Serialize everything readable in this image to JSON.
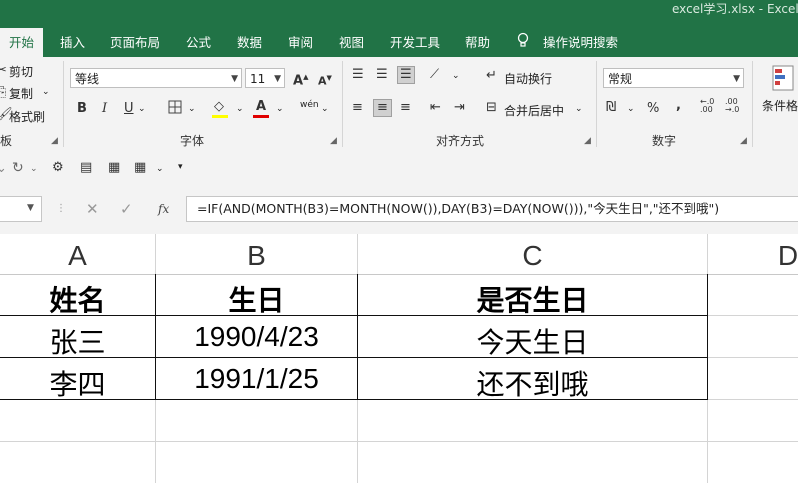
{
  "window": {
    "title": "excel学习.xlsx  -  Excel"
  },
  "tabs": [
    "开始",
    "插入",
    "页面布局",
    "公式",
    "数据",
    "审阅",
    "视图",
    "开发工具",
    "帮助"
  ],
  "tell_me": "操作说明搜索",
  "clipboard": {
    "cut": "剪切",
    "copy": "复制",
    "format_painter": "格式刷",
    "group_label_partial": "板"
  },
  "font": {
    "name": "等线",
    "size": "11",
    "group_label": "字体",
    "bold": "B",
    "italic": "I",
    "underline": "U",
    "grow": "A",
    "shrink": "A",
    "color_letter": "A",
    "wen": "wén"
  },
  "alignment": {
    "wrap_text": "自动换行",
    "merge_center": "合并后居中",
    "group_label": "对齐方式"
  },
  "number": {
    "format": "常规",
    "percent": "%",
    "comma": ",",
    "group_label": "数字"
  },
  "styles": {
    "conditional_formatting": "条件格"
  },
  "formula_bar": {
    "fx": "fx",
    "formula": "=IF(AND(MONTH(B3)=MONTH(NOW()),DAY(B3)=DAY(NOW())),\"今天生日\",\"还不到哦\")"
  },
  "columns": [
    "A",
    "B",
    "C",
    "D"
  ],
  "rows": [
    [
      "姓名",
      "生日",
      "是否生日"
    ],
    [
      "张三",
      "1990/4/23",
      "今天生日"
    ],
    [
      "李四",
      "1991/1/25",
      "还不到哦"
    ]
  ],
  "colors": {
    "excel_green": "#217346",
    "font_color_bar": "#e00000",
    "fill_color_bar": "#ffff00"
  }
}
